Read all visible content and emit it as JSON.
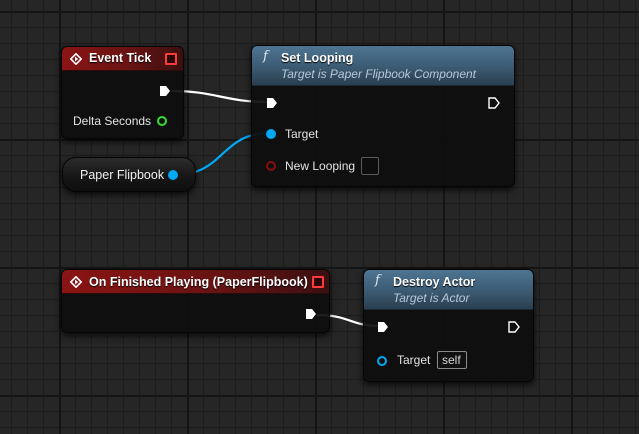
{
  "graph": {
    "event_tick": {
      "title": "Event Tick",
      "output_param": "Delta Seconds"
    },
    "set_looping": {
      "title": "Set Looping",
      "subtitle": "Target is Paper Flipbook Component",
      "target_label": "Target",
      "new_looping_label": "New Looping"
    },
    "paper_flipbook_var": {
      "label": "Paper Flipbook"
    },
    "on_finished_playing": {
      "title": "On Finished Playing (PaperFlipbook)"
    },
    "destroy_actor": {
      "title": "Destroy Actor",
      "subtitle": "Target is Actor",
      "target_label": "Target",
      "target_default": "self"
    }
  },
  "colors": {
    "event_header": "#8a1414",
    "function_header": "#4e7592",
    "exec_wire": "#ffffff",
    "object_pin": "#00a8f3",
    "float_pin": "#33dd33",
    "bool_pin": "#8a0d0d",
    "grid_bg": "#262626"
  },
  "icons": {
    "event": "event-diamond-icon",
    "function": "function-f-icon",
    "exec": "exec-arrow-icon",
    "close": "delegate-square-icon"
  }
}
